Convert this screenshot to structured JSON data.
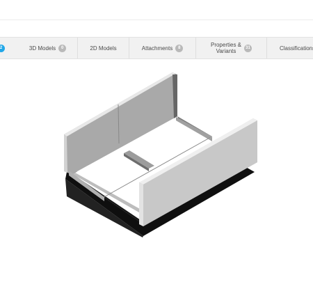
{
  "tabs": [
    {
      "id": "tab-active",
      "label": "",
      "badge": "2",
      "active": true
    },
    {
      "id": "3d-models",
      "label": "3D Models",
      "badge": "0"
    },
    {
      "id": "2d-models",
      "label": "2D Models",
      "badge": ""
    },
    {
      "id": "attachments",
      "label": "Attachments",
      "badge": "8"
    },
    {
      "id": "properties-variants",
      "label_line1": "Properties &",
      "label_line2": "Variants",
      "badge": "31"
    },
    {
      "id": "classifications",
      "label": "Classifications",
      "badge": ""
    }
  ],
  "colors": {
    "accent": "#21a7e8",
    "tab_bg": "#f1f1f1",
    "badge_gray": "#b9b9b9"
  },
  "viewer": {
    "model_icon": "roof-curb-3d-model"
  }
}
